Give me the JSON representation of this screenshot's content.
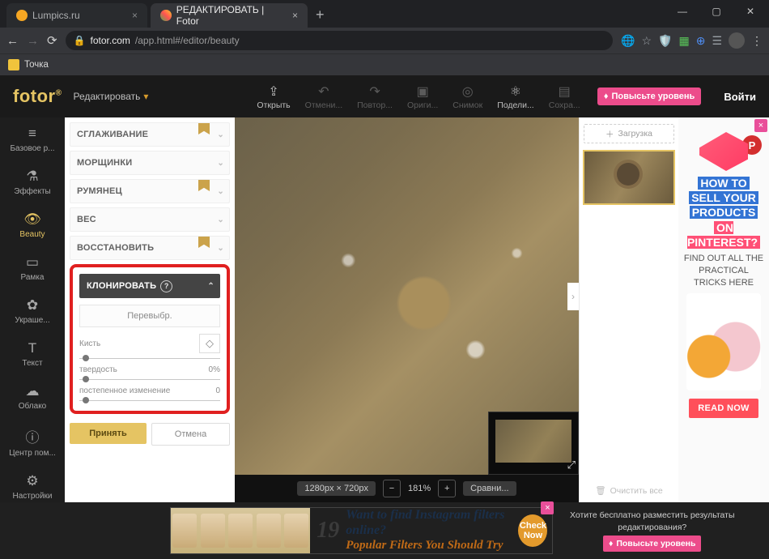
{
  "browser": {
    "tabs": [
      {
        "title": "Lumpics.ru",
        "active": false,
        "favicon": "#f5a623"
      },
      {
        "title": "РЕДАКТИРОВАТЬ | Fotor",
        "active": true,
        "favicon": "#4caf50"
      }
    ],
    "url_host": "fotor.com",
    "url_path": "/app.html#/editor/beauty",
    "bookmark": "Точка"
  },
  "header": {
    "brand": "fotor",
    "menu": "Редактировать",
    "actions": {
      "open": "Открыть",
      "undo": "Отмени...",
      "redo": "Повтор...",
      "original": "Ориги...",
      "snapshot": "Снимок",
      "share": "Подели...",
      "save": "Сохра..."
    },
    "upgrade": "Повысьте уровень",
    "signin": "Войти"
  },
  "rail": {
    "basic": "Базовое р...",
    "effects": "Эффекты",
    "beauty": "Beauty",
    "frame": "Рамка",
    "decor": "Украше...",
    "text": "Текст",
    "cloud": "Облако",
    "help_center": "Центр пом...",
    "settings": "Настройки"
  },
  "accordion": {
    "smoothing": "СГЛАЖИВАНИЕ",
    "wrinkles": "МОРЩИНКИ",
    "blush": "РУМЯНЕЦ",
    "weight": "ВЕС",
    "restore": "ВОССТАНОВИТЬ",
    "clone": "КЛОНИРОВАТЬ"
  },
  "clone_panel": {
    "reselect": "Перевыбр.",
    "brush_label": "Кисть",
    "hardness_label": "твердость",
    "hardness_value": "0%",
    "fade_label": "постепенное изменение",
    "fade_value": "0",
    "accept": "Принять",
    "cancel": "Отмена"
  },
  "canvas": {
    "dims": "1280px × 720px",
    "zoom": "181%",
    "compare": "Сравни..."
  },
  "right_panel": {
    "upload": "Загрузка",
    "clear": "Очистить все"
  },
  "right_ad": {
    "line1": "HOW TO",
    "line2": "SELL YOUR",
    "line3": "PRODUCTS",
    "line4": "ON PINTEREST?",
    "sub": "FIND OUT ALL THE PRACTICAL TRICKS HERE",
    "cta": "READ NOW"
  },
  "banner": {
    "number": "19",
    "line1": "Want to find Instagram filters online?",
    "line2": "Popular Filters You Should Try",
    "cta": "Check Now"
  },
  "promo": {
    "text": "Хотите бесплатно разместить результаты редактирования?",
    "btn": "Повысьте уровень"
  }
}
